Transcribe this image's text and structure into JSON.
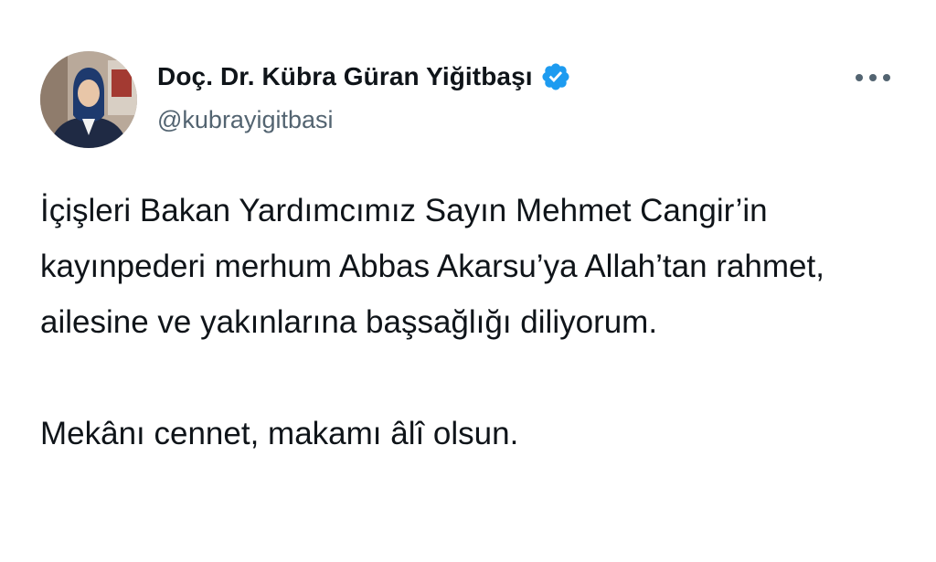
{
  "author": {
    "display_name": "Doç. Dr. Kübra Güran Yiğitbaşı",
    "handle": "@kubrayigitbasi",
    "verified_icon": "verified-badge-icon"
  },
  "menu": {
    "icon": "more-options-icon"
  },
  "tweet": {
    "paragraph_1": "İçişleri Bakan Yardımcımız Sayın Mehmet Cangir’in kayınpederi merhum Abbas Akarsu’ya Allah’tan rahmet, ailesine ve yakınlarına başsağlığı diliyorum.",
    "paragraph_2": "Mekânı cennet, makamı âlî olsun."
  },
  "colors": {
    "text": "#0f1419",
    "secondary": "#536471",
    "verified": "#1d9bf0"
  }
}
